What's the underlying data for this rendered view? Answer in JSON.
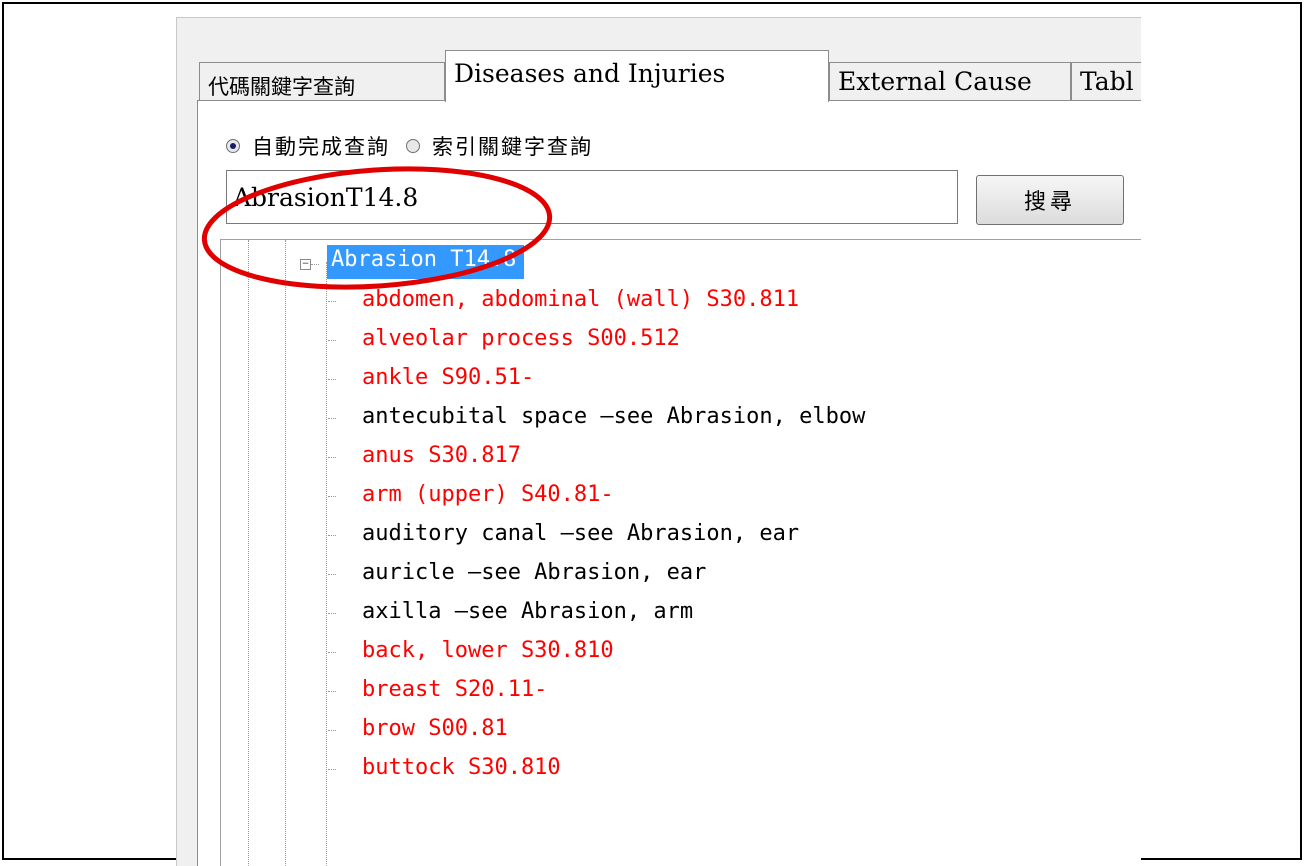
{
  "tabs": [
    {
      "label": "代碼關鍵字查詢",
      "active": false
    },
    {
      "label": "Diseases and Injuries",
      "active": true
    },
    {
      "label": "External Cause",
      "active": false
    },
    {
      "label": "Tabl",
      "active": false
    }
  ],
  "search_mode": {
    "options": [
      {
        "label": "自動完成查詢",
        "checked": true
      },
      {
        "label": "索引關鍵字查詢",
        "checked": false
      }
    ]
  },
  "search": {
    "value": "AbrasionT14.8",
    "button_label": "搜尋"
  },
  "tree": {
    "root_label": "Abrasion T14.8",
    "items": [
      {
        "label": "abdomen, abdominal (wall) S30.811",
        "color": "red"
      },
      {
        "label": "alveolar process S00.512",
        "color": "red"
      },
      {
        "label": "ankle S90.51-",
        "color": "red"
      },
      {
        "label": "antecubital space —see Abrasion, elbow",
        "color": "black"
      },
      {
        "label": "anus S30.817",
        "color": "red"
      },
      {
        "label": "arm (upper) S40.81-",
        "color": "red"
      },
      {
        "label": "auditory canal —see Abrasion, ear",
        "color": "black"
      },
      {
        "label": "auricle —see Abrasion, ear",
        "color": "black"
      },
      {
        "label": "axilla —see Abrasion, arm",
        "color": "black"
      },
      {
        "label": "back, lower S30.810",
        "color": "red"
      },
      {
        "label": "breast S20.11-",
        "color": "red"
      },
      {
        "label": "brow S00.81",
        "color": "red"
      },
      {
        "label": "buttock S30.810",
        "color": "red"
      }
    ]
  },
  "colors": {
    "selection": "#3399ff",
    "code_red": "#ff0000",
    "annotation": "#e00000"
  }
}
